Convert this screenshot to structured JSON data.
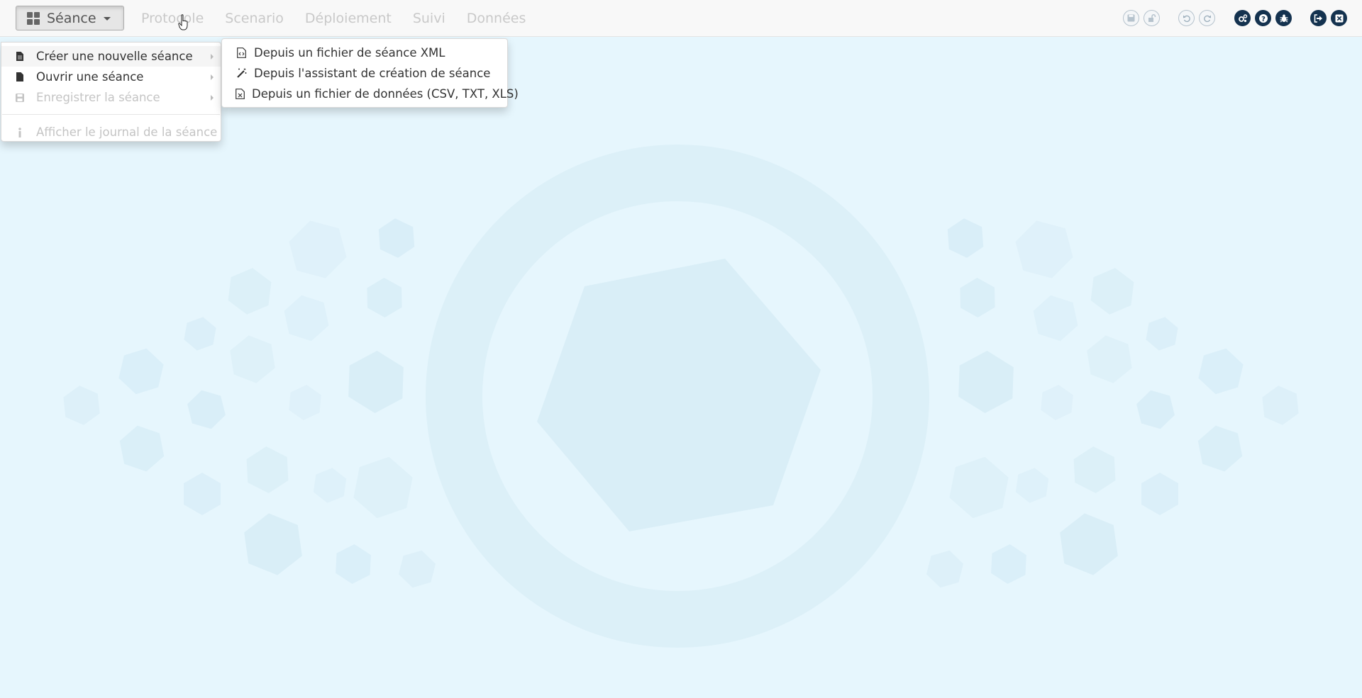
{
  "topbar": {
    "seance_label": "Séance",
    "nav": [
      "Protocole",
      "Scenario",
      "Déploiement",
      "Suivi",
      "Données"
    ],
    "tools": [
      {
        "name": "save-icon",
        "style": "light"
      },
      {
        "name": "unlock-icon",
        "style": "light"
      },
      {
        "name": "undo-icon",
        "style": "light"
      },
      {
        "name": "redo-icon",
        "style": "light"
      },
      {
        "name": "settings-icon",
        "style": "dark"
      },
      {
        "name": "help-icon",
        "style": "dark"
      },
      {
        "name": "bug-icon",
        "style": "dark"
      },
      {
        "name": "logout-icon",
        "style": "dark"
      },
      {
        "name": "close-icon",
        "style": "dark"
      }
    ]
  },
  "menu": {
    "items": [
      {
        "label": "Créer une nouvelle séance",
        "icon": "file-icon",
        "state": "active",
        "submenu": true
      },
      {
        "label": "Ouvrir une séance",
        "icon": "file-icon",
        "state": "normal",
        "submenu": true
      },
      {
        "label": "Enregistrer la séance",
        "icon": "floppy-icon",
        "state": "disabled",
        "submenu": true
      },
      {
        "label": "Afficher le journal de la séance",
        "icon": "info-icon",
        "state": "disabled",
        "submenu": false
      }
    ]
  },
  "submenu": {
    "items": [
      {
        "label": "Depuis un fichier de séance XML",
        "icon": "file-code-icon"
      },
      {
        "label": "Depuis l'assistant de création de séance",
        "icon": "magic-wand-icon"
      },
      {
        "label": "Depuis un fichier de données (CSV, TXT, XLS)",
        "icon": "file-excel-icon"
      }
    ]
  },
  "colors": {
    "background": "#e6f6fd",
    "artwork": "#d3ebf5",
    "nav_disabled": "#c9c9c9",
    "icon_dark": "#14324f"
  }
}
